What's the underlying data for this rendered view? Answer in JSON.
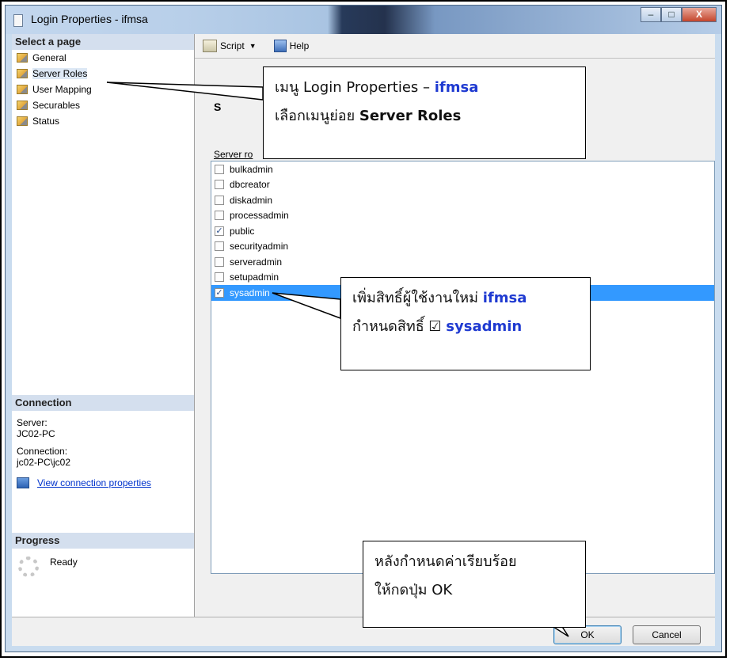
{
  "window": {
    "title": "Login Properties - ifmsa",
    "caption_minimize": "–",
    "caption_maximize": "□",
    "caption_close": "X"
  },
  "left_pane": {
    "select_header": "Select a page",
    "pages": [
      {
        "label": "General",
        "icon": "page-icon"
      },
      {
        "label": "Server Roles",
        "icon": "page-icon"
      },
      {
        "label": "User Mapping",
        "icon": "page-icon"
      },
      {
        "label": "Securables",
        "icon": "page-icon"
      },
      {
        "label": "Status",
        "icon": "page-icon"
      }
    ],
    "connection": {
      "header": "Connection",
      "server_label": "Server:",
      "server_value": "JC02-PC",
      "connection_label": "Connection:",
      "connection_value": "jc02-PC\\jc02",
      "link_text": "View connection properties"
    },
    "progress": {
      "header": "Progress",
      "status": "Ready"
    }
  },
  "toolbar": {
    "script_label": "Script",
    "help_label": "Help"
  },
  "main": {
    "heading": "S",
    "roles_caption": "Server ro",
    "roles": [
      {
        "name": "bulkadmin",
        "check": ""
      },
      {
        "name": "dbcreator",
        "check": ""
      },
      {
        "name": "diskadmin",
        "check": ""
      },
      {
        "name": "processadmin",
        "check": ""
      },
      {
        "name": "public",
        "check": "✓"
      },
      {
        "name": "securityadmin",
        "check": ""
      },
      {
        "name": "serveradmin",
        "check": ""
      },
      {
        "name": "setupadmin",
        "check": ""
      },
      {
        "name": "sysadmin",
        "check": "✓"
      }
    ]
  },
  "buttons": {
    "ok": "OK",
    "cancel": "Cancel"
  },
  "callouts": {
    "c1_line1": "เมนู Login Properties –",
    "c1_hl": "ifmsa",
    "c1_line2a": "เลือกเมนูย่อย",
    "c1_line2b": "Server Roles",
    "c2_line1": "เพิ่มสิทธิ์ผู้ใช้งานใหม่",
    "c2_hl1": "ifmsa",
    "c2_line2": "กำหนดสิทธิ์ ☑",
    "c2_hl2": "sysadmin",
    "c3_line1": "หลังกำหนดค่าเรียบร้อย",
    "c3_line2": "ให้กดปุ่ม OK"
  },
  "colors": {
    "accent": "#1f3ad1",
    "selection": "#3399ff",
    "section_bg": "#d4dfee"
  }
}
